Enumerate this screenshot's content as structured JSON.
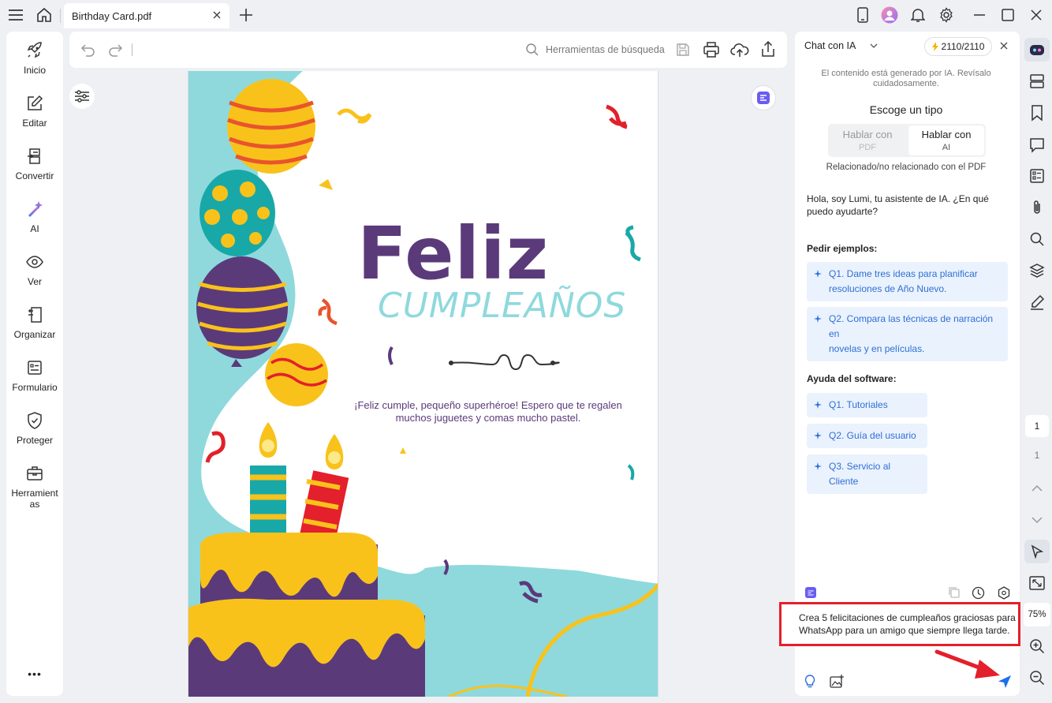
{
  "tab": {
    "title": "Birthday Card.pdf"
  },
  "sidebar": {
    "items": [
      {
        "label": "Inicio"
      },
      {
        "label": "Editar"
      },
      {
        "label": "Convertir"
      },
      {
        "label": "AI"
      },
      {
        "label": "Ver"
      },
      {
        "label": "Organizar"
      },
      {
        "label": "Formulario"
      },
      {
        "label": "Proteger"
      },
      {
        "label": "Herramient as"
      }
    ],
    "more": "•••"
  },
  "toolbar": {
    "search_placeholder": "Herramientas de búsqueda"
  },
  "card": {
    "title": "Feliz",
    "subtitle": "CUMPLEAÑOS",
    "message_line1": "¡Feliz cumple, pequeño superhéroe! Espero que te regalen",
    "message_line2": "muchos juguetes y comas mucho pastel."
  },
  "chat": {
    "mode_label": "Chat con IA",
    "credits": "2110/2110",
    "disclaimer_line1": "El contenido está generado por IA. Revísalo",
    "disclaimer_line2": "cuidadosamente.",
    "choose_type": "Escoge un tipo",
    "option_pdf_line1": "Hablar con",
    "option_pdf_line2": "PDF",
    "option_ai_line1": "Hablar con",
    "option_ai_line2": "AI",
    "related_note": "Relacionado/no relacionado con el PDF",
    "greeting_line1": "Hola, soy Lumi, tu asistente de IA. ¿En qué",
    "greeting_line2": "puedo ayudarte?",
    "examples_title": "Pedir ejemplos:",
    "examples": [
      {
        "line1": "Q1. Dame tres ideas para planificar",
        "line2": "resoluciones de Año Nuevo."
      },
      {
        "line1": "Q2. Compara las técnicas de narración en",
        "line2": "novelas y en películas."
      }
    ],
    "help_title": "Ayuda del software:",
    "help": [
      {
        "label": "Q1. Tutoriales"
      },
      {
        "label": "Q2. Guía del usuario"
      },
      {
        "label": "Q3. Servicio al Cliente"
      }
    ],
    "input_line1": "Crea 5 felicitaciones de cumpleaños graciosas para",
    "input_line2": "WhatsApp para un amigo que siempre llega tarde."
  },
  "rail": {
    "page_current": "1",
    "page_total": "1",
    "zoom": "75%"
  },
  "colors": {
    "accent_blue": "#2f6fd6",
    "purple": "#5b3a7a",
    "teal": "#8fd9dd",
    "yellow": "#f9c21b",
    "highlight_red": "#e3202b"
  },
  "icons": {
    "menu": "hamburger-icon",
    "home": "home-icon",
    "add_tab": "plus-icon",
    "mobile": "mobile-icon",
    "avatar": "avatar",
    "bell": "bell-icon",
    "settings": "gear-icon",
    "minimize": "minimize-icon",
    "maximize": "maximize-icon",
    "close": "close-icon"
  }
}
